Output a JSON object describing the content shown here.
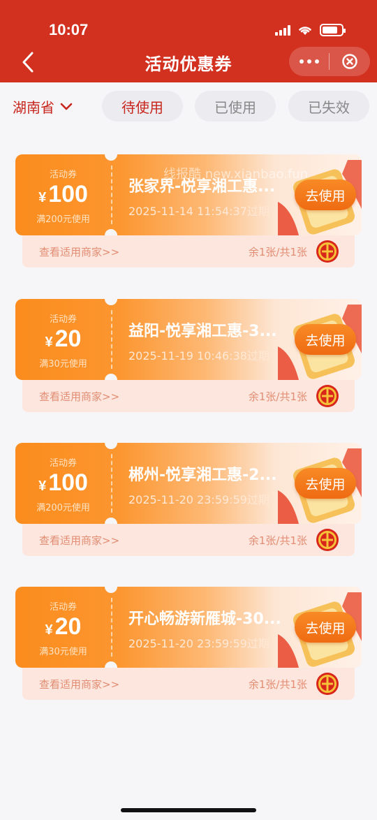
{
  "status_bar": {
    "time": "10:07"
  },
  "nav": {
    "title": "活动优惠券"
  },
  "filters": {
    "province": "湖南省",
    "tabs": [
      {
        "label": "待使用",
        "active": true
      },
      {
        "label": "已使用",
        "active": false
      },
      {
        "label": "已失效",
        "active": false
      }
    ]
  },
  "watermark": "线报酷 new.xianbao.fun",
  "coupons": [
    {
      "kind": "活动券",
      "currency": "¥",
      "amount": "100",
      "condition": "满200元使用",
      "title": "张家界-悦享湘工惠...",
      "expiry": "2025-11-14 11:54:37过期",
      "button": "去使用",
      "link": "查看适用商家>>",
      "remain": "余1张/共1张"
    },
    {
      "kind": "活动券",
      "currency": "¥",
      "amount": "20",
      "condition": "满30元使用",
      "title": "益阳-悦享湘工惠-3...",
      "expiry": "2025-11-19 10:46:38过期",
      "button": "去使用",
      "link": "查看适用商家>>",
      "remain": "余1张/共1张"
    },
    {
      "kind": "活动券",
      "currency": "¥",
      "amount": "100",
      "condition": "满200元使用",
      "title": "郴州-悦享湘工惠-2...",
      "expiry": "2025-11-20 23:59:59过期",
      "button": "去使用",
      "link": "查看适用商家>>",
      "remain": "余1张/共1张"
    },
    {
      "kind": "活动券",
      "currency": "¥",
      "amount": "20",
      "condition": "满30元使用",
      "title": "开心畅游新雁城-30...",
      "expiry": "2025-11-20 23:59:59过期",
      "button": "去使用",
      "link": "查看适用商家>>",
      "remain": "余1张/共1张"
    }
  ],
  "colors": {
    "header": "#d23120",
    "accent": "#c7251c",
    "coupon_orange": "#fb8c1d"
  },
  "icons": [
    "back-arrow-icon",
    "more-dots-icon",
    "close-circle-icon",
    "chevron-down-icon",
    "trade-union-logo-icon",
    "gift-ticket-decoration-icon"
  ]
}
